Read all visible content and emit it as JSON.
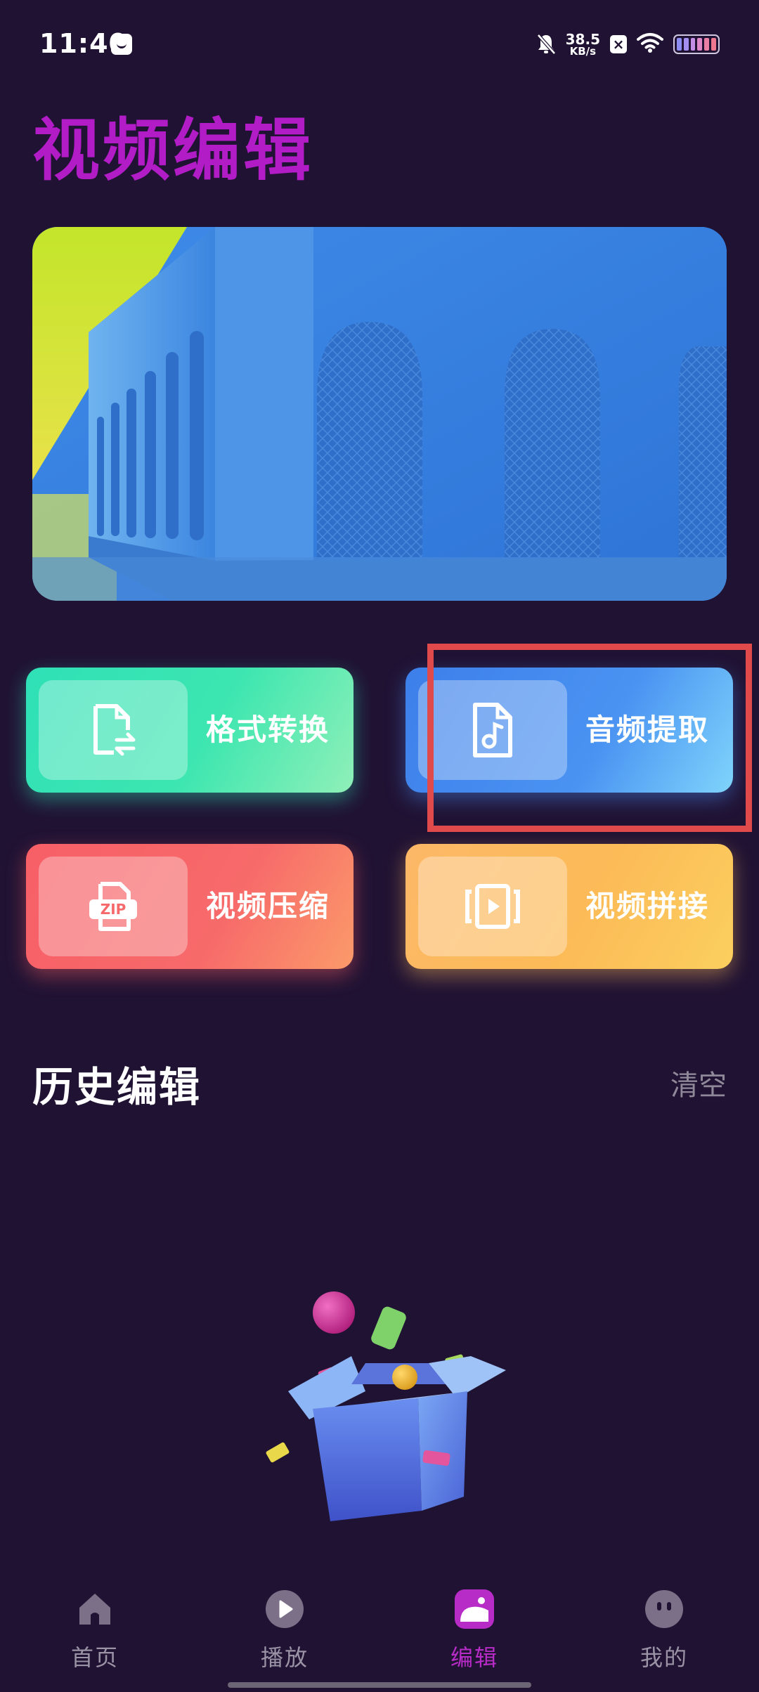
{
  "status_bar": {
    "time": "11:40",
    "net_speed_value": "38.5",
    "net_speed_unit": "KB/s",
    "icons": [
      "message-icon",
      "bell-muted-icon",
      "x-badge-icon",
      "wifi-icon",
      "battery-icon"
    ]
  },
  "page_title": "视频编辑",
  "tools": {
    "format_convert": {
      "label": "格式转换",
      "icon": "file-convert-icon",
      "color": "#35e2b4"
    },
    "audio_extract": {
      "label": "音频提取",
      "icon": "music-file-icon",
      "color": "#4a8ff0"
    },
    "video_compress": {
      "label": "视频压缩",
      "icon": "zip-icon",
      "color": "#f76468"
    },
    "video_merge": {
      "label": "视频拼接",
      "icon": "video-frame-icon",
      "color": "#fcb95c"
    }
  },
  "highlight_color": "#e04a4a",
  "history": {
    "title": "历史编辑",
    "clear_label": "清空"
  },
  "bottom_nav": {
    "items": [
      {
        "label": "首页",
        "icon": "home-icon",
        "active": false
      },
      {
        "label": "播放",
        "icon": "play-icon",
        "active": false
      },
      {
        "label": "编辑",
        "icon": "edit-icon",
        "active": true
      },
      {
        "label": "我的",
        "icon": "profile-icon",
        "active": false
      }
    ],
    "active_color": "#b72cc7"
  }
}
